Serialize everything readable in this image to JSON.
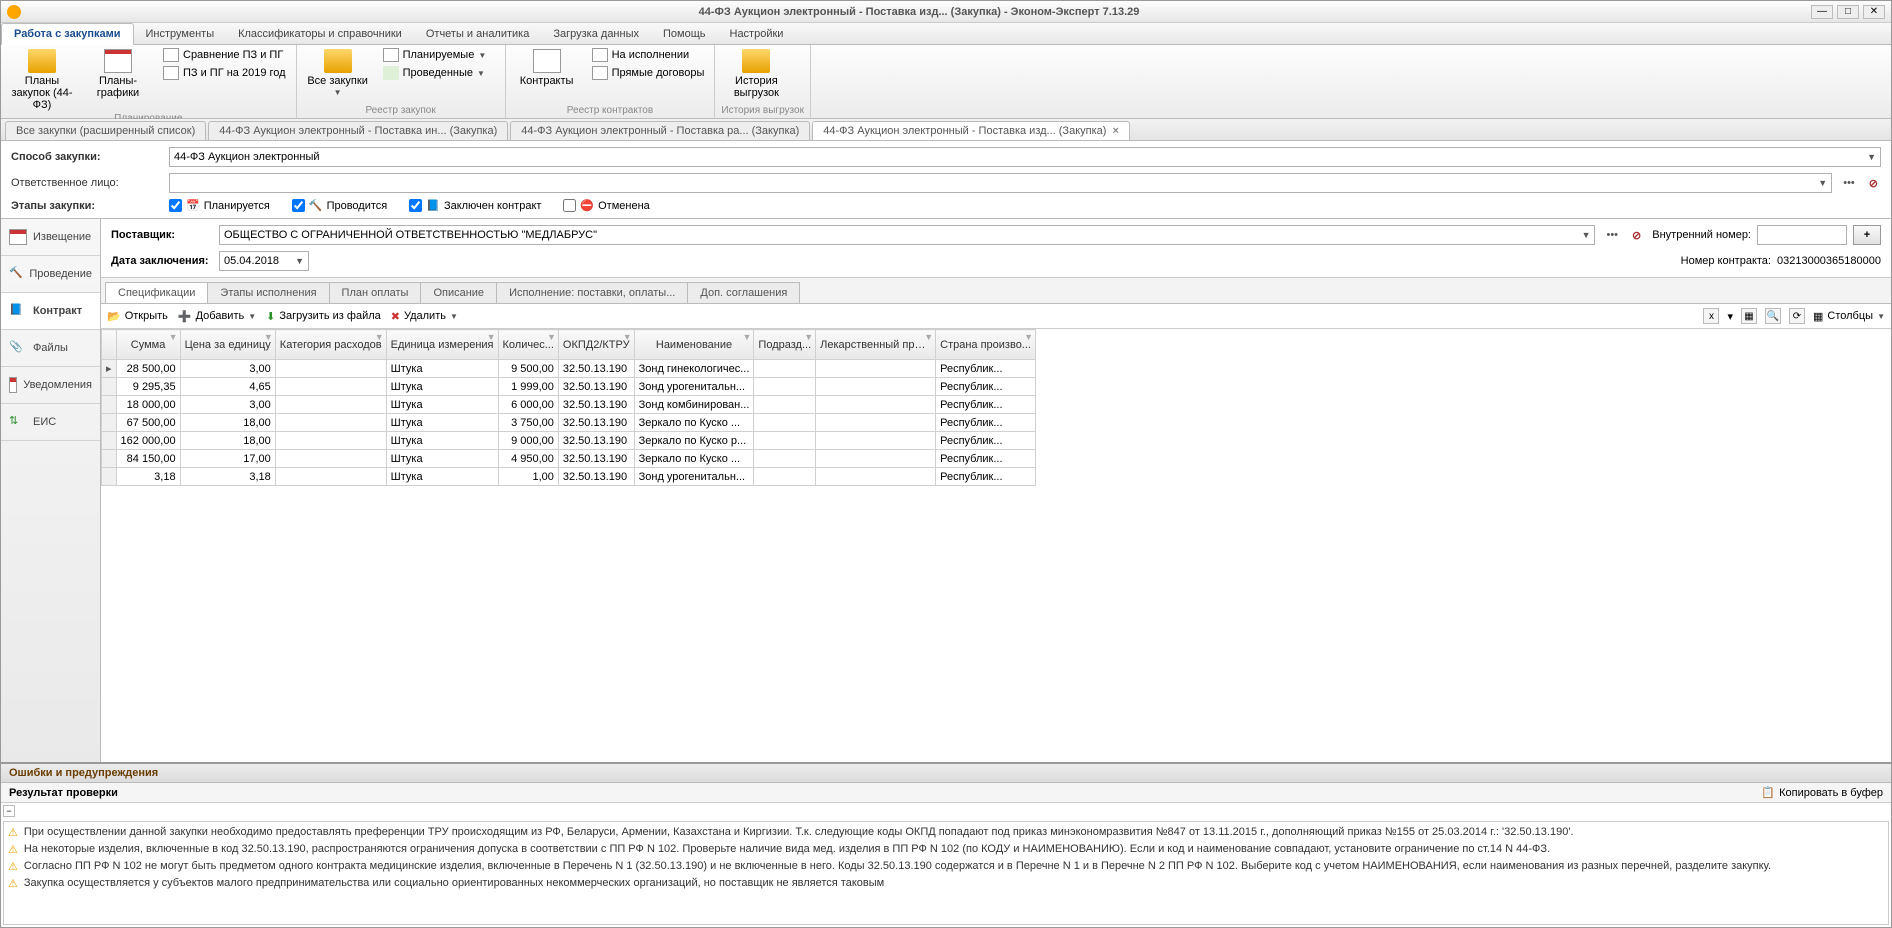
{
  "window": {
    "title": "44-ФЗ Аукцион электронный - Поставка изд... (Закупка) - Эконом-Эксперт 7.13.29"
  },
  "menu": {
    "tabs": [
      "Работа с закупками",
      "Инструменты",
      "Классификаторы и справочники",
      "Отчеты и аналитика",
      "Загрузка данных",
      "Помощь",
      "Настройки"
    ]
  },
  "ribbon": {
    "group1": {
      "label": "Планирование",
      "big1": "Планы закупок (44-ФЗ)",
      "big2": "Планы-графики",
      "s1": "Сравнение ПЗ и ПГ",
      "s2": "ПЗ и ПГ на 2019 год"
    },
    "group2": {
      "label": "Реестр закупок",
      "big": "Все закупки",
      "s1": "Планируемые",
      "s2": "Проведенные"
    },
    "group3": {
      "label": "Реестр контрактов",
      "big": "Контракты",
      "s1": "На исполнении",
      "s2": "Прямые договоры"
    },
    "group4": {
      "label": "История выгрузок",
      "big": "История выгрузок"
    }
  },
  "doctabs": [
    "Все закупки (расширенный список)",
    "44-ФЗ Аукцион электронный - Поставка  ин... (Закупка)",
    "44-ФЗ Аукцион электронный - Поставка  ра... (Закупка)",
    "44-ФЗ Аукцион электронный - Поставка изд... (Закупка)"
  ],
  "form": {
    "method_label": "Способ закупки:",
    "method_value": "44-ФЗ Аукцион электронный",
    "resp_label": "Ответственное лицо:",
    "stages_label": "Этапы закупки:",
    "chk1": "Планируется",
    "chk2": "Проводится",
    "chk3": "Заключен контракт",
    "chk4": "Отменена"
  },
  "sidenav": [
    "Извещение",
    "Проведение",
    "Контракт",
    "Файлы",
    "Уведомления",
    "ЕИС"
  ],
  "supplier": {
    "label": "Поставщик:",
    "value": "ОБЩЕСТВО С ОГРАНИЧЕННОЙ ОТВЕТСТВЕННОСТЬЮ \"МЕДЛАБРУС\"",
    "date_label": "Дата заключения:",
    "date_value": "05.04.2018",
    "intnum_label": "Внутренний номер:",
    "contractnum_label": "Номер контракта:",
    "contractnum_value": "03213000365180000"
  },
  "subtabs": [
    "Спецификации",
    "Этапы исполнения",
    "План оплаты",
    "Описание",
    "Исполнение: поставки, оплаты...",
    "Доп. соглашения"
  ],
  "toolbar": {
    "open": "Открыть",
    "add": "Добавить",
    "load": "Загрузить из файла",
    "del": "Удалить",
    "cols": "Столбцы"
  },
  "grid": {
    "headers": [
      "Сумма",
      "Цена за единицу",
      "Категория расходов",
      "Единица измерения",
      "Количес...",
      "ОКПД2/КТРУ",
      "Наименование",
      "Подразд...",
      "Лекарственный препарат",
      "Страна произво..."
    ],
    "rows": [
      {
        "sum": "28 500,00",
        "price": "3,00",
        "cat": "",
        "unit": "Штука",
        "qty": "9 500,00",
        "okpd": "32.50.13.190",
        "name": "Зонд гинекологичес...",
        "sub": "",
        "med": "",
        "country": "Республик..."
      },
      {
        "sum": "9 295,35",
        "price": "4,65",
        "cat": "",
        "unit": "Штука",
        "qty": "1 999,00",
        "okpd": "32.50.13.190",
        "name": "Зонд урогенитальн...",
        "sub": "",
        "med": "",
        "country": "Республик..."
      },
      {
        "sum": "18 000,00",
        "price": "3,00",
        "cat": "",
        "unit": "Штука",
        "qty": "6 000,00",
        "okpd": "32.50.13.190",
        "name": "Зонд комбинирован...",
        "sub": "",
        "med": "",
        "country": "Республик..."
      },
      {
        "sum": "67 500,00",
        "price": "18,00",
        "cat": "",
        "unit": "Штука",
        "qty": "3 750,00",
        "okpd": "32.50.13.190",
        "name": "Зеркало  по Куско ...",
        "sub": "",
        "med": "",
        "country": "Республик..."
      },
      {
        "sum": "162 000,00",
        "price": "18,00",
        "cat": "",
        "unit": "Штука",
        "qty": "9 000,00",
        "okpd": "32.50.13.190",
        "name": "Зеркало  по Куско р...",
        "sub": "",
        "med": "",
        "country": "Республик..."
      },
      {
        "sum": "84 150,00",
        "price": "17,00",
        "cat": "",
        "unit": "Штука",
        "qty": "4 950,00",
        "okpd": "32.50.13.190",
        "name": "Зеркало  по Куско ...",
        "sub": "",
        "med": "",
        "country": "Республик..."
      },
      {
        "sum": "3,18",
        "price": "3,18",
        "cat": "",
        "unit": "Штука",
        "qty": "1,00",
        "okpd": "32.50.13.190",
        "name": "Зонд урогенитальн...",
        "sub": "",
        "med": "",
        "country": "Республик..."
      }
    ]
  },
  "errors": {
    "title": "Ошибки и предупреждения",
    "subtitle": "Результат проверки",
    "copy": "Копировать в буфер",
    "rows": [
      "При осуществлении данной закупки необходимо предоставлять преференции ТРУ происходящим из РФ, Беларуси, Армении, Казахстана и Киргизии. Т.к. следующие коды ОКПД попадают под приказ минэкономразвития №847 от 13.11.2015 г., дополняющий приказ №155 от 25.03.2014 г.: '32.50.13.190'.",
      "На некоторые изделия, включенные в код 32.50.13.190, распространяются ограничения допуска в соответствии с ПП РФ N 102. Проверьте наличие вида мед. изделия в ПП РФ N 102 (по КОДУ и НАИМЕНОВАНИЮ). Если и код и наименование совпадают, установите ограничение по ст.14 N 44-ФЗ.",
      "Согласно ПП РФ N 102 не могут быть предметом одного контракта медицинские изделия, включенные в Перечень N 1 (32.50.13.190) и не включенные в него. Коды 32.50.13.190 содержатся и в Перечне N 1 и в Перечне N 2 ПП РФ N 102. Выберите код с учетом НАИМЕНОВАНИЯ, если наименования из разных перечней, разделите закупку.",
      "Закупка осуществляется у субъектов малого предпринимательства или социально ориентированных некоммерческих организаций, но поставщик не является таковым"
    ]
  }
}
